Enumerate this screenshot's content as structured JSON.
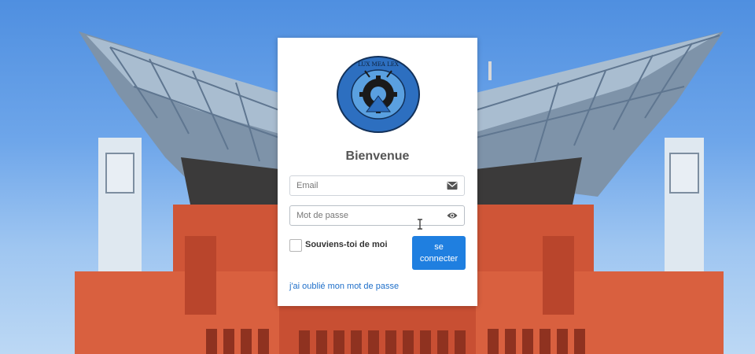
{
  "login": {
    "logo_text_top": "LUX MEA LEX",
    "title": "Bienvenue",
    "email_placeholder": "Email",
    "password_placeholder": "Mot de passe",
    "remember_label": "Souviens-toi de moi",
    "submit_label": "se connecter",
    "forgot_link": "j'ai oublié mon mot de passe"
  },
  "icons": {
    "email": "envelope-icon",
    "password": "eye-icon",
    "cursor": "text-cursor-icon"
  },
  "colors": {
    "primary": "#1f7fe0",
    "link": "#1f6fc9",
    "logo_blue": "#2d6fc0",
    "building_red": "#d45a3a"
  }
}
